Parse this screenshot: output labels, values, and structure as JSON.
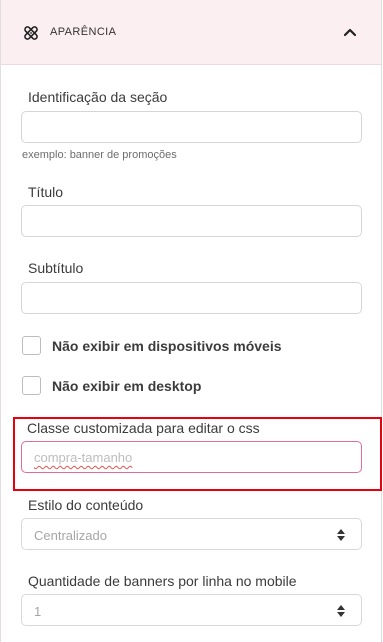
{
  "section": {
    "title": "APARÊNCIA",
    "icon": "crossed-tools-icon",
    "collapse_icon": "chevron-up-icon"
  },
  "fields": {
    "identificacao": {
      "label": "Identificação da seção",
      "value": "",
      "hint": "exemplo: banner de promoções"
    },
    "titulo": {
      "label": "Título",
      "value": ""
    },
    "subtitulo": {
      "label": "Subtítulo",
      "value": ""
    },
    "hide_mobile": {
      "label": "Não exibir em dispositivos móveis",
      "checked": false
    },
    "hide_desktop": {
      "label": "Não exibir em desktop",
      "checked": false
    },
    "classe_css": {
      "label": "Classe customizada para editar o css",
      "value": "compra-tamanho"
    },
    "estilo": {
      "label": "Estilo do conteúdo",
      "selected": "Centralizado"
    },
    "banners_mobile": {
      "label": "Quantidade de banners por linha no mobile",
      "selected": "1"
    }
  },
  "colors": {
    "header_bg": "#fbeff2",
    "highlight_border": "#e8000f",
    "active_input_border": "#e56a9c"
  }
}
